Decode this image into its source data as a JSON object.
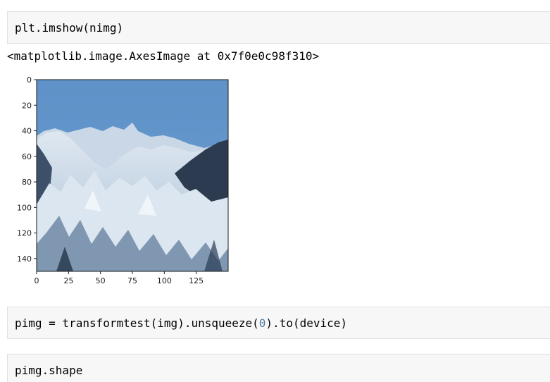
{
  "cells": [
    {
      "code_before": "plt.imshow(nimg)",
      "code_num": "",
      "code_after": ""
    },
    {
      "code_before": "pimg = transformtest(img).unsqueeze(",
      "code_num": "0",
      "code_after": ").to(device)"
    },
    {
      "code_before": "pimg.shape",
      "code_num": "",
      "code_after": ""
    }
  ],
  "output": {
    "repr": "<matplotlib.image.AxesImage at 0x7f0e0c98f310>"
  },
  "chart_data": {
    "type": "image",
    "xlim": [
      0,
      150
    ],
    "ylim": [
      150,
      0
    ],
    "xticks": [
      0,
      25,
      50,
      75,
      100,
      125
    ],
    "yticks": [
      0,
      20,
      40,
      60,
      80,
      100,
      120,
      140
    ],
    "xtick_labels": [
      "0",
      "25",
      "50",
      "75",
      "100",
      "125"
    ],
    "ytick_labels": [
      "0",
      "20",
      "40",
      "60",
      "80",
      "100",
      "120",
      "140"
    ],
    "colors": {
      "sky": "#5b8ec4",
      "snow": "#e6edf4",
      "shadow": "#2a3a4e",
      "mid": "#8fa9c3"
    }
  }
}
